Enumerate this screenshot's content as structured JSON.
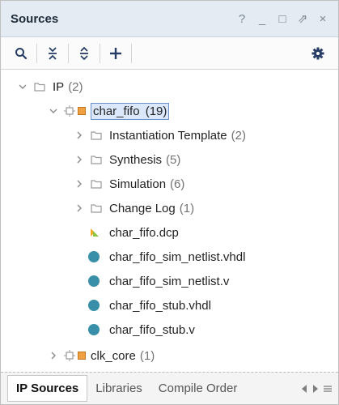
{
  "panel": {
    "title": "Sources",
    "window_controls": [
      "?",
      "_",
      "□",
      "⇗",
      "×"
    ]
  },
  "toolbar": {
    "icons": [
      "search-icon",
      "collapse-all-icon",
      "expand-all-icon",
      "add-icon",
      "settings-icon"
    ]
  },
  "tree": {
    "ip": {
      "label": "IP",
      "count": "(2)"
    },
    "char_fifo": {
      "label": "char_fifo",
      "count": "(19)"
    },
    "instantiation": {
      "label": "Instantiation Template",
      "count": "(2)"
    },
    "synthesis": {
      "label": "Synthesis",
      "count": "(5)"
    },
    "simulation": {
      "label": "Simulation",
      "count": "(6)"
    },
    "changelog": {
      "label": "Change Log",
      "count": "(1)"
    },
    "files": [
      "char_fifo.dcp",
      "char_fifo_sim_netlist.vhdl",
      "char_fifo_sim_netlist.v",
      "char_fifo_stub.vhdl",
      "char_fifo_stub.v"
    ],
    "clk_core": {
      "label": "clk_core",
      "count": "(1)"
    }
  },
  "tabs": {
    "ip_sources": "IP Sources",
    "libraries": "Libraries",
    "compile_order": "Compile Order"
  },
  "colors": {
    "accent": "#283d66",
    "selection": "#dbe8fb",
    "file_dot": "#3a8fa8",
    "ip_orange": "#f0a040"
  }
}
